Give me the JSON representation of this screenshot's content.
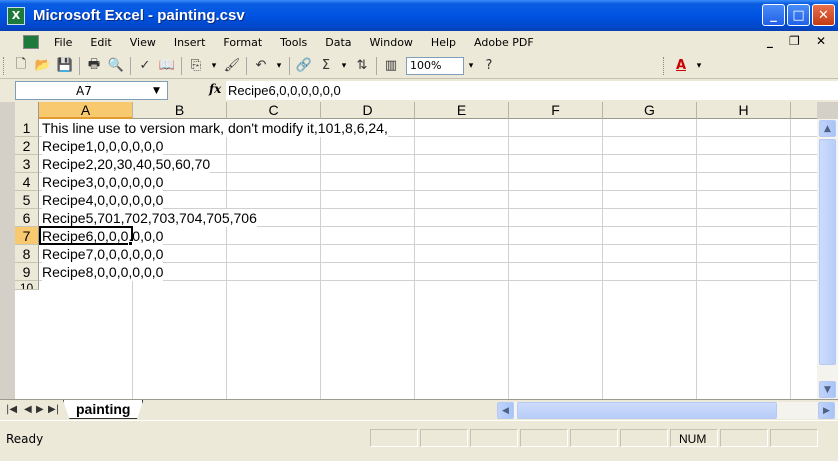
{
  "window": {
    "title": "Microsoft Excel - painting.csv",
    "app_icon_glyph": "X",
    "buttons": {
      "minimize": "_",
      "maximize": "□",
      "close": "✕"
    }
  },
  "menu": {
    "items": [
      "File",
      "Edit",
      "View",
      "Insert",
      "Format",
      "Tools",
      "Data",
      "Window",
      "Help",
      "Adobe PDF"
    ],
    "doc_controls": "_ ❐ ✕"
  },
  "toolbar": {
    "zoom": "100%",
    "icons": [
      "new-icon",
      "open-icon",
      "save-icon",
      "permission-icon",
      "print-icon",
      "print-preview-icon",
      "spelling-icon",
      "research-icon",
      "copy-icon",
      "format-painter-icon",
      "undo-icon",
      "hyperlink-icon",
      "autosum-icon",
      "sort-ascending-icon",
      "chart-wizard-icon",
      "help-icon",
      "font-color-icon"
    ]
  },
  "formula": {
    "name_box": "A7",
    "fx_label": "fx",
    "value": "Recipe6,0,0,0,0,0,0"
  },
  "columns": [
    "A",
    "B",
    "C",
    "D",
    "E",
    "F",
    "G",
    "H"
  ],
  "selected_column": "A",
  "rows": [
    {
      "num": "1",
      "text": "This line use to version mark, don't modify it,101,8,6,24,"
    },
    {
      "num": "2",
      "text": "Recipe1,0,0,0,0,0,0"
    },
    {
      "num": "3",
      "text": "Recipe2,20,30,40,50,60,70"
    },
    {
      "num": "4",
      "text": "Recipe3,0,0,0,0,0,0"
    },
    {
      "num": "5",
      "text": "Recipe4,0,0,0,0,0,0"
    },
    {
      "num": "6",
      "text": "Recipe5,701,702,703,704,705,706"
    },
    {
      "num": "7",
      "text": "Recipe6,0,0,0,0,0,0"
    },
    {
      "num": "8",
      "text": "Recipe7,0,0,0,0,0,0"
    },
    {
      "num": "9",
      "text": "Recipe8,0,0,0,0,0,0"
    },
    {
      "num": "10",
      "text": ""
    }
  ],
  "selected_row": "7",
  "sheet_tab": "painting",
  "status": {
    "text": "Ready",
    "num": "NUM"
  }
}
